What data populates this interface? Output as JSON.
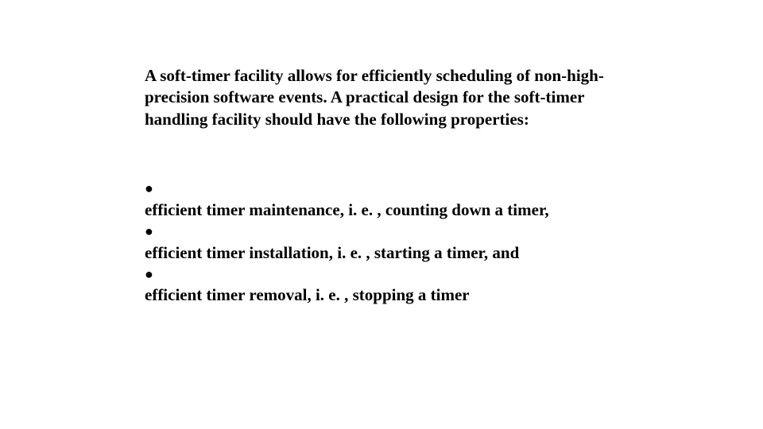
{
  "intro": "A soft-timer facility allows for efficiently scheduling of non-high-precision software events. A practical design for the soft-timer handling facility should have the following properties:",
  "bullets": {
    "b1": "●",
    "t1": "efficient timer maintenance, i. e. , counting down a timer,",
    "b2": "●",
    "t2": "efficient timer installation, i. e. , starting a timer, and",
    "b3": "●",
    "t3": "efficient timer removal, i. e. , stopping a timer"
  }
}
